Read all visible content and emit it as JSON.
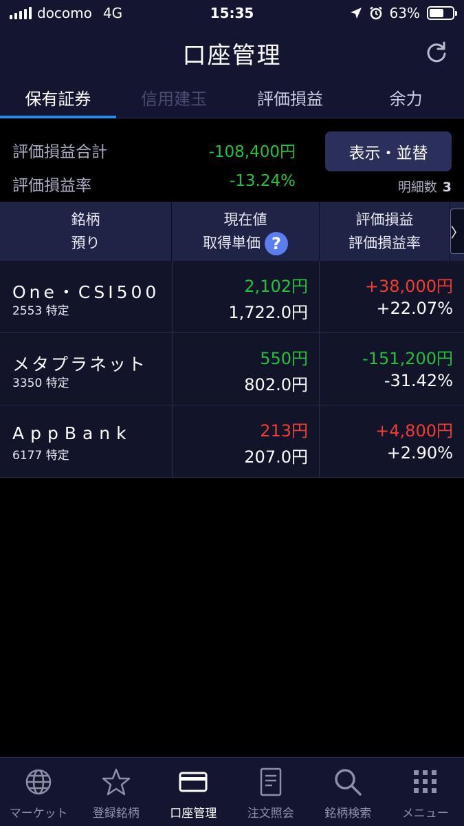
{
  "status": {
    "carrier": "docomo",
    "network": "4G",
    "time": "15:35",
    "battery": "63%",
    "battery_level": 0.63
  },
  "header": {
    "title": "口座管理"
  },
  "tabs": [
    {
      "label": "保有証券"
    },
    {
      "label": "信用建玉"
    },
    {
      "label": "評価損益"
    },
    {
      "label": "余力"
    }
  ],
  "summary": {
    "total_label": "評価損益合計",
    "total_value": "-108,400円",
    "rate_label": "評価損益率",
    "rate_value": "-13.24%",
    "sort_button": "表示・並替",
    "count_label": "明細数",
    "count_value": "3"
  },
  "table_header": {
    "col1_line1": "銘柄",
    "col1_line2": "預り",
    "col2_line1": "現在値",
    "col2_line2": "取得単価",
    "help": "?",
    "col3_line1": "評価損益",
    "col3_line2": "評価損益率",
    "more": "〉"
  },
  "rows": [
    {
      "name": "One・CSI500",
      "code": "2553 特定",
      "price": "2,102円",
      "cost": "1,722.0円",
      "pl": "+38,000円",
      "rate": "+22.07%"
    },
    {
      "name": "メタプラネット",
      "code": "3350 特定",
      "price": "550円",
      "cost": "802.0円",
      "pl": "-151,200円",
      "rate": "-31.42%"
    },
    {
      "name": "AppBank",
      "code": "6177 特定",
      "price": "213円",
      "cost": "207.0円",
      "pl": "+4,800円",
      "rate": "+2.90%"
    }
  ],
  "nav": [
    {
      "label": "マーケット"
    },
    {
      "label": "登録銘柄"
    },
    {
      "label": "口座管理"
    },
    {
      "label": "注文照会"
    },
    {
      "label": "銘柄検索"
    },
    {
      "label": "メニュー"
    }
  ],
  "colors": {
    "positive": "#f23c32",
    "negative": "#23c23b",
    "accent": "#2b8ce8"
  }
}
